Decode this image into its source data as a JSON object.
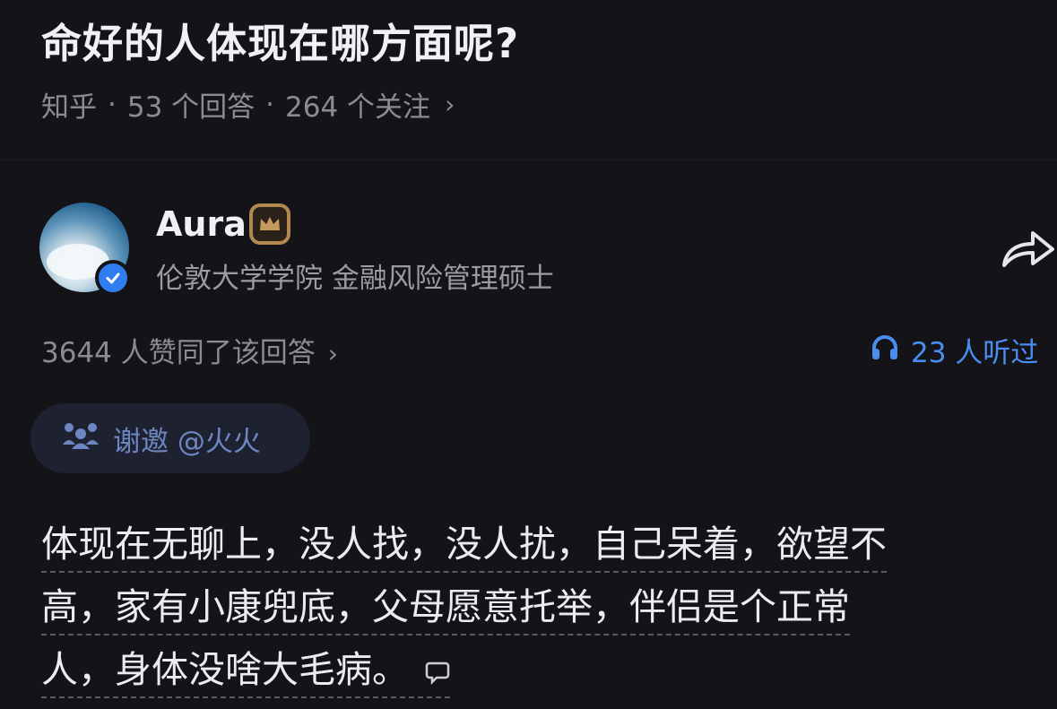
{
  "question": {
    "title": "命好的人体现在哪方面呢?",
    "source": "知乎",
    "answers_count": "53 个回答",
    "followers_count": "264 个关注"
  },
  "author": {
    "name": "Aura",
    "description": "伦敦大学学院 金融风险管理硕士"
  },
  "stats": {
    "likes": "3644 人赞同了该回答",
    "listened": "23 人听过"
  },
  "invite": {
    "label": "谢邀 @火火"
  },
  "answer": {
    "lines": [
      "体现在无聊上，没人找，没人扰，自己呆着，欲望不",
      "高，家有小康兜底，父母愿意托举，伴侣是个正常",
      "人，身体没啥大毛病。"
    ]
  },
  "colors": {
    "background": "#131318",
    "accent_blue": "#4a8df0",
    "badge_gold": "#b08850"
  },
  "icons": [
    "chevron-right-icon",
    "verified-icon",
    "crown-badge-icon",
    "share-icon",
    "headphone-icon",
    "invite-icon",
    "comment-icon"
  ]
}
